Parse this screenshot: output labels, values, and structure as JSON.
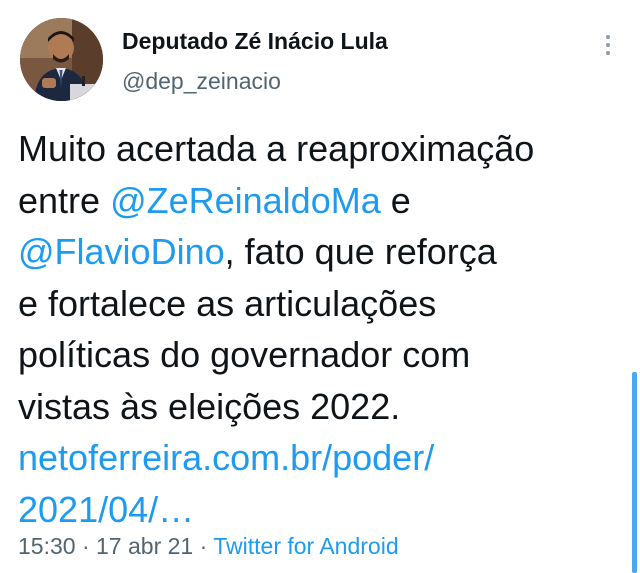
{
  "author": {
    "display_name": "Deputado Zé Inácio Lula",
    "handle": "@dep_zeinacio",
    "avatar": "profile-photo"
  },
  "menu": {
    "icon": "more-vertical-icon"
  },
  "tweet": {
    "line1": "Muito acertada a reaproximação",
    "line2_pre": "entre ",
    "mention1": "@ZeReinaldoMa",
    "line2_post": " e",
    "mention2": "@FlavioDino",
    "line3_post": ", fato que reforça",
    "line4": "e fortalece as articulações",
    "line5": "políticas do governador com",
    "line6": "vistas às eleições 2022.",
    "link_line1": "netoferreira.com.br/poder/",
    "link_line2": "2021/04/…"
  },
  "meta": {
    "time": "15:30",
    "sep1": " · ",
    "date": "17 abr 21",
    "sep2": " · ",
    "source": "Twitter for Android"
  },
  "colors": {
    "link": "#1d9bf0",
    "text": "#0f1419",
    "secondary": "#536471",
    "scrollbar": "#4aa8ee"
  }
}
